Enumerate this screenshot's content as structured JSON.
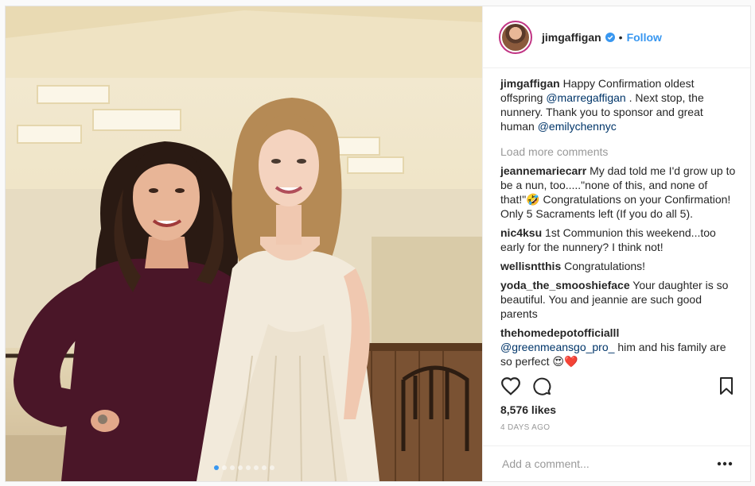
{
  "post": {
    "username": "jimgaffigan",
    "separator": "•",
    "follow_label": "Follow",
    "caption": {
      "user": "jimgaffigan",
      "text_1": "Happy Confirmation oldest offspring",
      "mention_1": "@marregaffigan",
      "text_2": ". Next stop, the nunnery. Thank you to sponsor and great human",
      "mention_2": "@emilychennyc"
    },
    "load_more": "Load more comments",
    "comments": [
      {
        "user": "jeannemariecarr",
        "text": "My dad told me I'd grow up to be a nun, too.....\"none of this, and none of that!\"🤣 Congratulations on your Confirmation! Only 5 Sacraments left (If you do all 5)."
      },
      {
        "user": "nic4ksu",
        "text": "1st Communion this weekend...too early for the nunnery? I think not!"
      },
      {
        "user": "wellisntthis",
        "text": "Congratulations!"
      },
      {
        "user": "yoda_the_smooshieface",
        "text": "Your daughter is so beautiful. You and jeannie are such good parents"
      },
      {
        "user": "thehomedepotofficialll",
        "mention": "@greenmeansgo_pro_",
        "text": "him and his family are so perfect 😍❤️"
      }
    ],
    "likes": "8,576 likes",
    "timestamp": "4 DAYS AGO",
    "comment_placeholder": "Add a comment...",
    "carousel": {
      "count": 8,
      "active": 0
    }
  },
  "icons": {
    "like": "heart-icon",
    "comment": "comment-icon",
    "save": "bookmark-icon",
    "more": "more-options-icon",
    "verified": "verified-badge-icon"
  },
  "colors": {
    "link": "#3897f0",
    "mention": "#003569",
    "muted": "#999999",
    "avatar_ring": "#c13584"
  }
}
